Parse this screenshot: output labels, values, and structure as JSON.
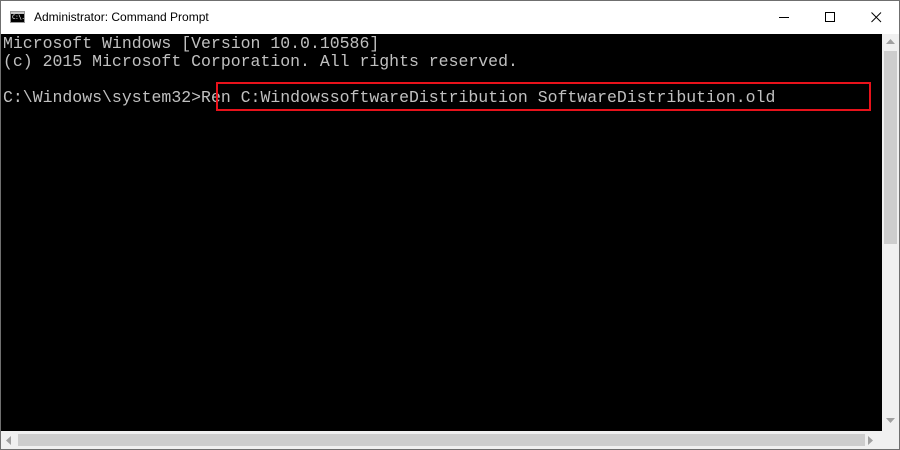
{
  "window": {
    "title": "Administrator: Command Prompt",
    "icon_text": "C:\\."
  },
  "console": {
    "line1": "Microsoft Windows [Version 10.0.10586]",
    "line2": "(c) 2015 Microsoft Corporation. All rights reserved.",
    "prompt": "C:\\Windows\\system32>",
    "command": "Ren C:WindowssoftwareDistribution SoftwareDistribution.old"
  },
  "icons": {
    "minimize": "minimize-icon",
    "maximize": "maximize-icon",
    "close": "close-icon",
    "app": "command-prompt-icon"
  },
  "colors": {
    "console_background": "#000000",
    "console_text": "#c0c0c0",
    "highlight_border": "#e8121b"
  }
}
